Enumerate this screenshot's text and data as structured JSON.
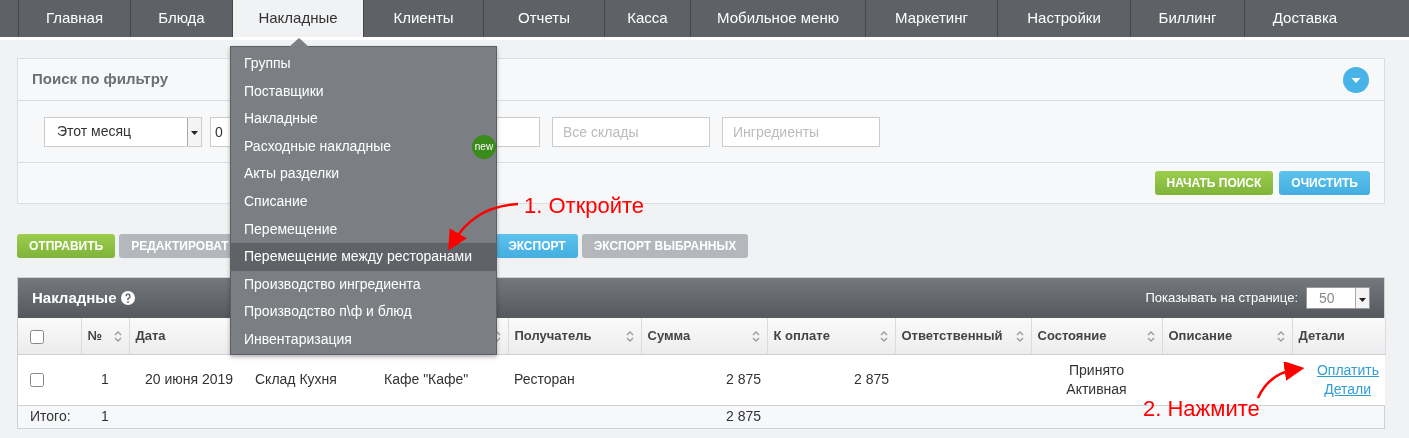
{
  "nav": {
    "tabs": [
      {
        "label": "Главная",
        "selected": false
      },
      {
        "label": "Блюда",
        "selected": false
      },
      {
        "label": "Накладные",
        "selected": true
      },
      {
        "label": "Клиенты",
        "selected": false
      },
      {
        "label": "Отчеты",
        "selected": false
      },
      {
        "label": "Касса",
        "selected": false
      },
      {
        "label": "Мобильное меню",
        "selected": false
      },
      {
        "label": "Маркетинг",
        "selected": false
      },
      {
        "label": "Настройки",
        "selected": false
      },
      {
        "label": "Биллинг",
        "selected": false
      },
      {
        "label": "Доставка",
        "selected": false
      }
    ]
  },
  "dropdown": {
    "items": [
      {
        "label": "Группы",
        "selected": false
      },
      {
        "label": "Поставщики",
        "selected": false
      },
      {
        "label": "Накладные",
        "selected": false
      },
      {
        "label": "Расходные накладные",
        "selected": false,
        "badge": "new"
      },
      {
        "label": "Акты разделки",
        "selected": false
      },
      {
        "label": "Списание",
        "selected": false
      },
      {
        "label": "Перемещение",
        "selected": false
      },
      {
        "label": "Перемещение между ресторанами",
        "selected": true
      },
      {
        "label": "Производство ингредиента",
        "selected": false
      },
      {
        "label": "Производство п\\ф и блюд",
        "selected": false
      },
      {
        "label": "Инвентаризация",
        "selected": false
      }
    ]
  },
  "filter": {
    "title": "Поиск по фильтру",
    "period": "Этот месяц",
    "date_from": "0",
    "warehouses": {
      "placeholder": "Все склады"
    },
    "ingredients": {
      "placeholder": "Ингредиенты"
    },
    "buttons": [
      {
        "label": "НАЧАТЬ ПОИСК",
        "kind": "success"
      },
      {
        "label": "ОЧИСТИТЬ",
        "kind": "info"
      }
    ]
  },
  "actions": [
    {
      "label": "ОТПРАВИТЬ",
      "kind": "success"
    },
    {
      "label": "РЕДАКТИРОВАТ",
      "kind": "muted"
    },
    {
      "label": "ЭКСПОРТ",
      "kind": "info"
    },
    {
      "label": "ЭКСПОРТ ВЫБРАННЫХ",
      "kind": "muted"
    }
  ],
  "table": {
    "title": "Накладные",
    "per_page_label": "Показывать на странице:",
    "per_page": "50",
    "header_checked": false,
    "columns": [
      {
        "label": "№",
        "sortable": true
      },
      {
        "label": "Дата",
        "sortable": false
      },
      {},
      {
        "sortable": true
      },
      {
        "label": "Получатель",
        "sortable": true
      },
      {
        "label": "Сумма",
        "sortable": true
      },
      {
        "label": "К оплате",
        "sortable": true
      },
      {
        "label": "Ответственный",
        "sortable": true
      },
      {
        "label": "Состояние",
        "sortable": true
      },
      {
        "label": "Описание",
        "sortable": true
      },
      {
        "label": "Детали",
        "sortable": false
      }
    ],
    "rows": [
      {
        "checked": false,
        "number": "1",
        "date": "20 июня 2019",
        "from": "Склад Кухня",
        "to": "Кафе \"Кафе\"",
        "recipient": "Ресторан",
        "sum": "2 875",
        "to_pay": "2 875",
        "status": [
          "Принято",
          "Активная"
        ],
        "links": [
          "Оплатить",
          "Детали"
        ]
      }
    ],
    "totals": {
      "label": "Итого:",
      "count": "1",
      "sum": "2 875"
    }
  },
  "annotations": [
    "1. Откройте",
    "2. Нажмите"
  ]
}
